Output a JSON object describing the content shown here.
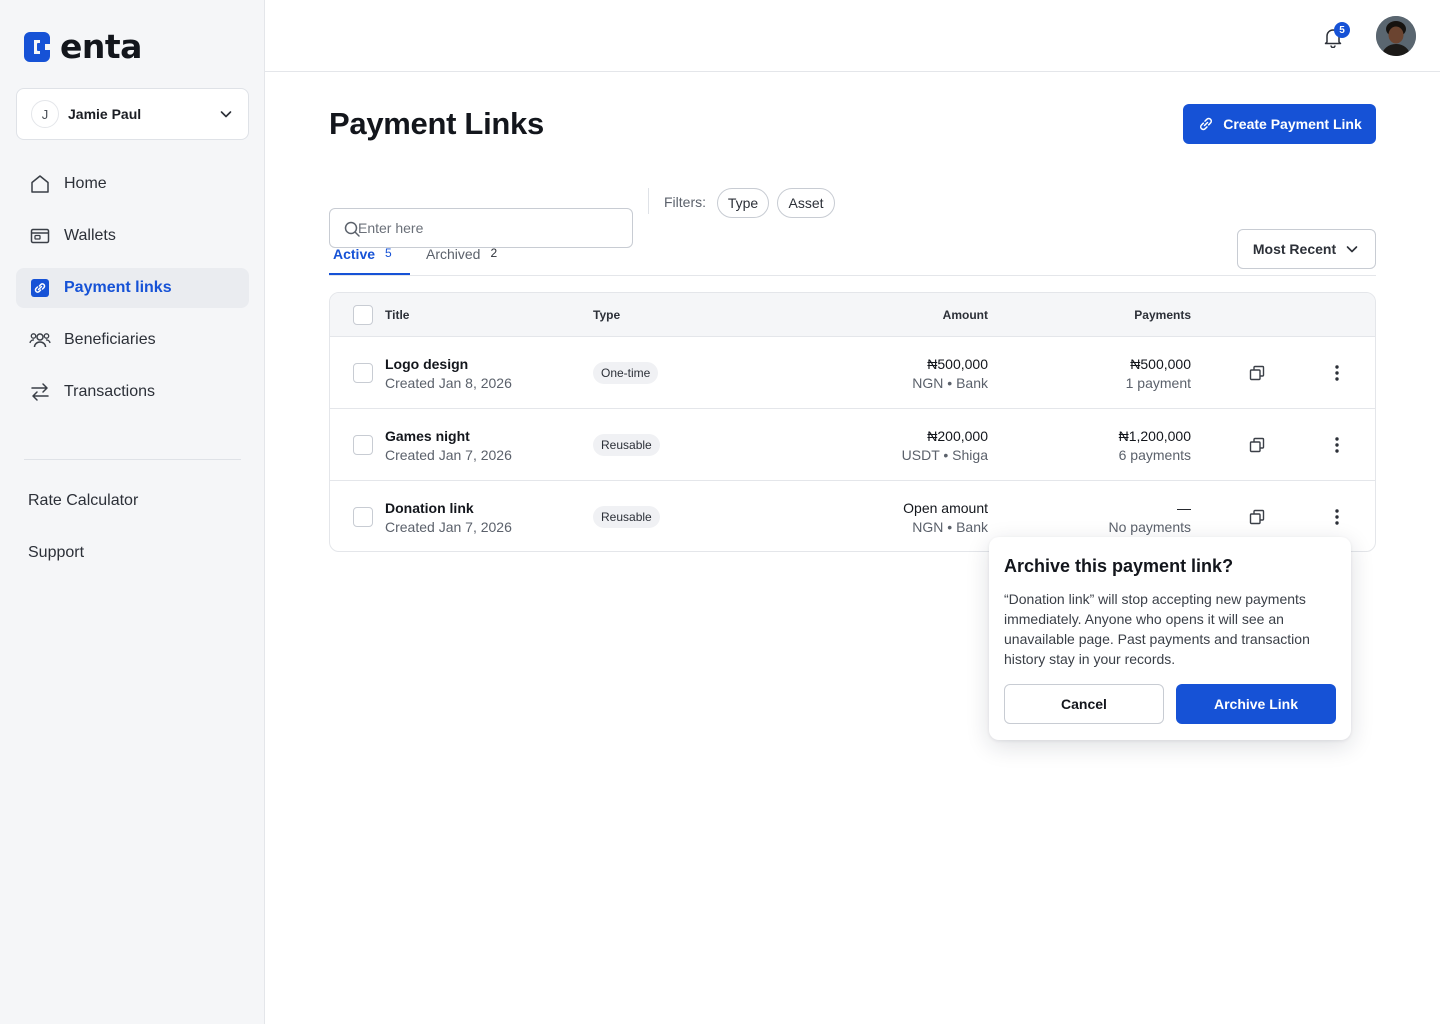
{
  "brand": {
    "name": "enta",
    "accent": "#1652d6"
  },
  "account": {
    "initial": "J",
    "name": "Jamie Paul"
  },
  "sidebar": {
    "items": [
      {
        "label": "Home",
        "icon": "home-icon"
      },
      {
        "label": "Wallets",
        "icon": "wallet-icon"
      },
      {
        "label": "Payment links",
        "icon": "link-icon",
        "active": true
      },
      {
        "label": "Beneficiaries",
        "icon": "users-icon"
      },
      {
        "label": "Transactions",
        "icon": "arrows-icon"
      }
    ],
    "secondary": [
      "Rate Calculator",
      "Support"
    ]
  },
  "topbar": {
    "notifications": "5"
  },
  "page": {
    "title": "Payment Links",
    "create_label": "Create Payment Link"
  },
  "search": {
    "placeholder": "Enter here"
  },
  "filters": {
    "label": "Filters:",
    "chips": [
      "Type",
      "Asset"
    ]
  },
  "tabs": [
    {
      "label": "Active",
      "count": "5"
    },
    {
      "label": "Archived",
      "count": "2"
    }
  ],
  "sort": {
    "label": "Most Recent"
  },
  "table": {
    "headers": {
      "title": "Title",
      "type": "Type",
      "amount": "Amount",
      "payments": "Payments"
    },
    "rows": [
      {
        "title": "Logo design",
        "created": "Created Jan 8, 2026",
        "type": "One-time",
        "amount": "₦500,000",
        "amount_sub": "NGN  •  Bank",
        "payments": "₦500,000",
        "payments_sub": "1 payment"
      },
      {
        "title": "Games night",
        "created": "Created Jan 7, 2026",
        "type": "Reusable",
        "amount": "₦200,000",
        "amount_sub": "USDT  •  Shiga",
        "payments": "₦1,200,000",
        "payments_sub": "6 payments"
      },
      {
        "title": "Donation link",
        "created": "Created Jan 7, 2026",
        "type": "Reusable",
        "amount": "Open amount",
        "amount_sub": "NGN  •  Bank",
        "payments": "—",
        "payments_sub": "No payments"
      }
    ]
  },
  "popover": {
    "title": "Archive this payment link?",
    "body": "“Donation link” will stop accepting new payments immediately. Anyone who opens it will see an unavailable page. Past payments and transaction history stay in your records.",
    "cancel_label": "Cancel",
    "confirm_label": "Archive Link"
  }
}
